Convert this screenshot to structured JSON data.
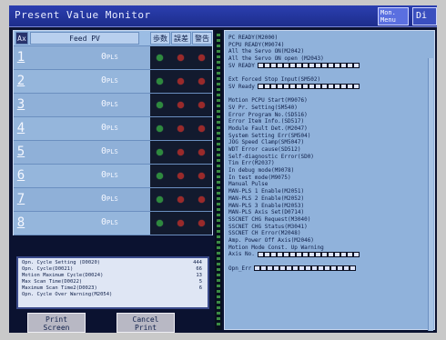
{
  "window": {
    "title": "Present Value Monitor",
    "mon_menu_label": "Mon. Menu",
    "disp_label": "Di"
  },
  "axis_table": {
    "headers": [
      "Ax",
      "Feed PV",
      "歩数",
      "誤差",
      "警告"
    ],
    "rows": [
      {
        "axis": "1",
        "feed_value": "0",
        "unit": "PLS"
      },
      {
        "axis": "2",
        "feed_value": "0",
        "unit": "PLS"
      },
      {
        "axis": "3",
        "feed_value": "0",
        "unit": "PLS"
      },
      {
        "axis": "4",
        "feed_value": "0",
        "unit": "PLS"
      },
      {
        "axis": "5",
        "feed_value": "0",
        "unit": "PLS"
      },
      {
        "axis": "6",
        "feed_value": "0",
        "unit": "PLS"
      },
      {
        "axis": "7",
        "feed_value": "0",
        "unit": "PLS"
      },
      {
        "axis": "8",
        "feed_value": "0",
        "unit": "PLS"
      }
    ],
    "lamp_colors": {
      "ok": "#2e8a3e",
      "off": "#9a2a2a"
    }
  },
  "info_box": {
    "lines": [
      {
        "label": "Opn. Cycle Setting (D0020)",
        "value": "444"
      },
      {
        "label": "Opn. Cycle(D0021)",
        "value": "66"
      },
      {
        "label": "Motion Maximum Cycle(D0024)",
        "value": "13"
      },
      {
        "label": "Max Scan Time(D0022)",
        "value": "5"
      },
      {
        "label": "Maximum Scan Time2(D0023)",
        "value": "6"
      },
      {
        "label": "Opn. Cycle Over Warning(M2054)",
        "value": ""
      }
    ]
  },
  "buttons": {
    "print_screen_line1": "Print",
    "print_screen_line2": "Screen",
    "cancel_print_line1": "Cancel",
    "cancel_print_line2": "Print"
  },
  "right_panel": {
    "lines": [
      "PC READY(M2000)",
      "PCPU READY(M9074)",
      "All the Servo ON(M2042)",
      "All the Servo ON open (M2043)",
      "SV READY",
      "",
      "Ext Forced Stop Input(SM502)",
      "SV Ready",
      "",
      "Motion PCPU Start(M9076)",
      "SV Pr. Setting(SM540)",
      "Error Program No.(SD516)",
      "Error Item Info.(SD517)",
      "Module Fault Det.(M2047)",
      "System Setting Err(SM504)",
      "JOG Speed Clamp(SM5047)",
      "WDT Error cause(SD512)",
      "Self-diagnostic Error(SD0)",
      "Tim Err(M2037)",
      "In debug mode(M9078)",
      "In test mode(M9075)",
      "Manual Pulse",
      "MAN-PLS 1 Enable(M2051)",
      "MAN-PLS 2 Enable(M2052)",
      "MAN-PLS 3 Enable(M2053)",
      "MAN-PLS Axis Set(D0714)",
      "SSCNET CHG Request(M3040)",
      "SSCNET CHG Status(M3041)",
      "SSCNET CH Error(M2048)",
      "Amp. Power Off Axis(M2046)",
      "Motion Mode Const. Up Warning",
      "Axis No.",
      "",
      "Opn_Err"
    ],
    "bar_lines": [
      "SV READY",
      "SV Ready",
      "Axis No.",
      "Opn_Err"
    ]
  }
}
